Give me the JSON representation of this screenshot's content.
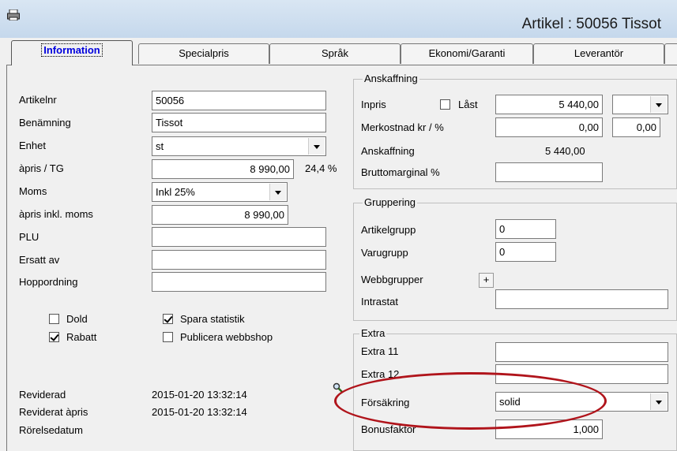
{
  "window": {
    "title": "Artikel : 50056 Tissot"
  },
  "tabs": [
    {
      "label": "Information"
    },
    {
      "label": "Specialpris"
    },
    {
      "label": "Språk"
    },
    {
      "label": "Ekonomi/Garanti"
    },
    {
      "label": "Leverantör"
    }
  ],
  "left": {
    "artikelnr_label": "Artikelnr",
    "artikelnr_value": "50056",
    "benamning_label": "Benämning",
    "benamning_value": "Tissot",
    "enhet_label": "Enhet",
    "enhet_value": "st",
    "apris_label": "àpris / TG",
    "apris_value": "8 990,00",
    "tg_value": "24,4 %",
    "moms_label": "Moms",
    "moms_value": "Inkl 25%",
    "apris_inkl_label": "àpris inkl. moms",
    "apris_inkl_value": "8 990,00",
    "plu_label": "PLU",
    "plu_value": "",
    "ersatt_label": "Ersatt av",
    "ersatt_value": "",
    "hoppordning_label": "Hoppordning",
    "hoppordning_value": "",
    "dold_label": "Dold",
    "dold_checked": false,
    "rabatt_label": "Rabatt",
    "rabatt_checked": true,
    "spara_label": "Spara statistik",
    "spara_checked": true,
    "publicera_label": "Publicera webbshop",
    "publicera_checked": false,
    "reviderad_label": "Reviderad",
    "reviderad_value": "2015-01-20 13:32:14",
    "reviderat_apris_label": "Reviderat àpris",
    "reviderat_apris_value": "2015-01-20 13:32:14",
    "rorelsedatum_label": "Rörelsedatum"
  },
  "anskaffning": {
    "title": "Anskaffning",
    "inpris_label": "Inpris",
    "last_label": "Låst",
    "last_checked": false,
    "inpris_value": "5 440,00",
    "inpris_combo_value": "",
    "merkostnad_label": "Merkostnad kr / %",
    "merkostnad_kr": "0,00",
    "merkostnad_pct": "0,00",
    "anskaffning_label": "Anskaffning",
    "anskaffning_value": "5 440,00",
    "brutto_label": "Bruttomarginal %",
    "brutto_value": ""
  },
  "gruppering": {
    "title": "Gruppering",
    "artikelgrupp_label": "Artikelgrupp",
    "artikelgrupp_value": "0",
    "varugrupp_label": "Varugrupp",
    "varugrupp_value": "0",
    "webbgrupper_label": "Webbgrupper",
    "webbgrupper_button": "+",
    "intrastat_label": "Intrastat",
    "intrastat_value": ""
  },
  "extra": {
    "title": "Extra",
    "extra11_label": "Extra 11",
    "extra11_value": "",
    "extra12_label": "Extra 12",
    "extra12_value": "",
    "forsakring_label": "Försäkring",
    "forsakring_value": "solid",
    "bonusfaktor_label": "Bonusfaktor",
    "bonusfaktor_value": "1,000"
  },
  "colors": {
    "highlight_oval": "#b0141b",
    "active_tab_text": "#0000dd"
  }
}
